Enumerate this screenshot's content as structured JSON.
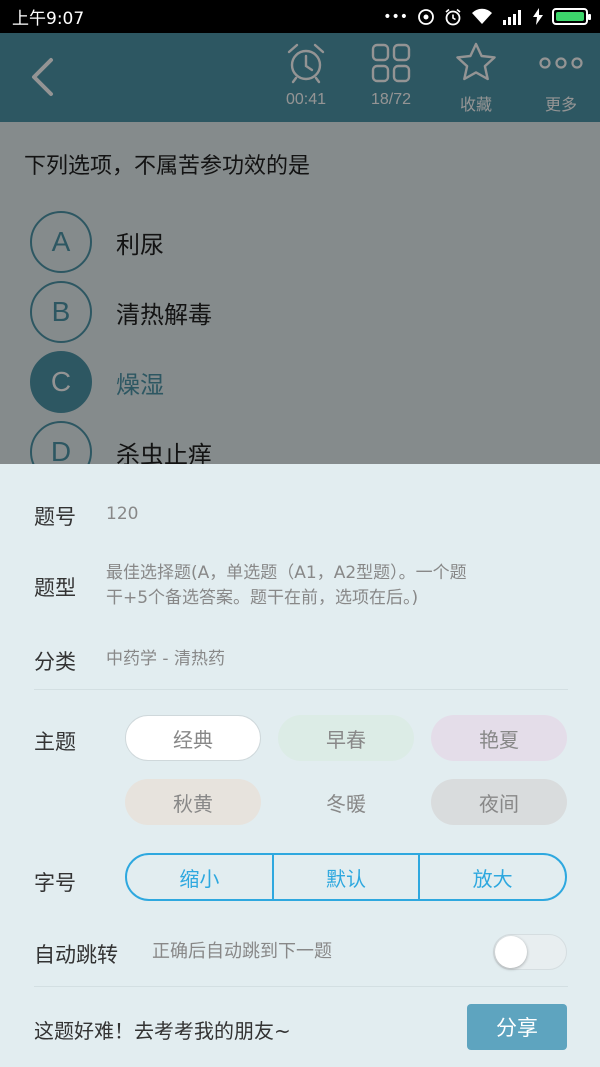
{
  "status_bar": {
    "time": "上午9:07",
    "dots": "•••"
  },
  "toolbar": {
    "timer": "00:41",
    "progress": "18/72",
    "favorite": "收藏",
    "more": "更多"
  },
  "question": {
    "text": "下列选项，不属苦参功效的是",
    "options": [
      {
        "letter": "A",
        "text": "利尿"
      },
      {
        "letter": "B",
        "text": "清热解毒"
      },
      {
        "letter": "C",
        "text": "燥湿",
        "selected": true
      },
      {
        "letter": "D",
        "text": "杀虫止痒"
      }
    ]
  },
  "sheet": {
    "number_label": "题号",
    "number_value": "120",
    "type_label": "题型",
    "type_value_line1": "最佳选择题(A，单选题（A1，A2型题）。一个题",
    "type_value_line2": "干+5个备选答案。题干在前，选项在后。)",
    "category_label": "分类",
    "category_value": "中药学 - 清热药",
    "theme_label": "主题",
    "themes": [
      {
        "name": "经典",
        "bg": "#ffffff",
        "color": "#888888",
        "selected": true
      },
      {
        "name": "早春",
        "bg": "#dcece6",
        "color": "#888888"
      },
      {
        "name": "艳夏",
        "bg": "#e4dde9",
        "color": "#888888"
      },
      {
        "name": "秋黄",
        "bg": "#e7e3dd",
        "color": "#888888"
      },
      {
        "name": "冬暖",
        "bg": "#e2edf0",
        "color": "#888888"
      },
      {
        "name": "夜间",
        "bg": "#d9dcdd",
        "color": "#888888"
      }
    ],
    "font_label": "字号",
    "font_options": [
      "缩小",
      "默认",
      "放大"
    ],
    "autojump_label": "自动跳转",
    "autojump_desc": "正确后自动跳到下一题",
    "autojump_on": false,
    "share_prompt": "这题好难！去考考我的朋友~",
    "share_button": "分享"
  },
  "colors": {
    "primary": "#4f97aa",
    "accent": "#2ea8df"
  }
}
